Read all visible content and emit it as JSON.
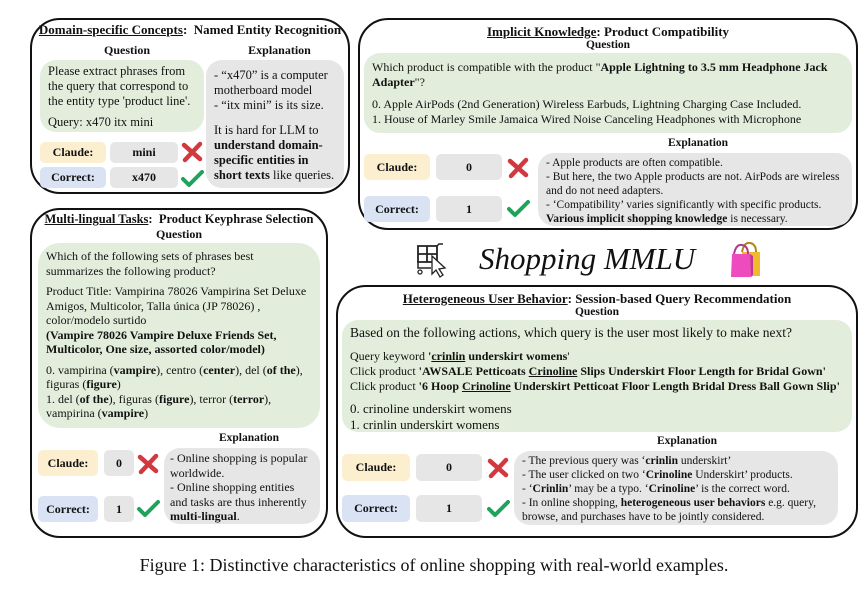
{
  "panels": {
    "ner": {
      "category": "Domain-specific Concepts",
      "task": "Named Entity Recognition",
      "question_header": "Question",
      "explanation_header": "Explanation",
      "question_lines": [
        "Please extract phrases from the query that correspond to the entity type 'product line'."
      ],
      "query": "Query: x470 itx mini",
      "claude_label": "Claude:",
      "claude_answer": "mini",
      "correct_label": "Correct:",
      "correct_answer": "x470",
      "explanation": {
        "b1": "- “x470” is a computer motherboard model",
        "b2": "- “itx mini” is its size.",
        "p_pre": "It is hard for LLM to ",
        "p_bold": "understand domain-specific entities in short texts",
        "p_post": " like queries."
      }
    },
    "compat": {
      "category": "Implicit Knowledge",
      "task": "Product Compatibility",
      "question_header": "Question",
      "explanation_header": "Explanation",
      "question_pre": "Which product is compatible with the product \"",
      "question_bold": "Apple Lightning to 3.5 mm Headphone Jack Adapter",
      "question_post": "\"?",
      "options": [
        "0. Apple AirPods (2nd Generation) Wireless Earbuds, Lightning Charging Case Included.",
        "1. House of Marley Smile Jamaica Wired Noise Canceling Headphones with Microphone"
      ],
      "claude_label": "Claude:",
      "claude_answer": "0",
      "correct_label": "Correct:",
      "correct_answer": "1",
      "explanation": {
        "b1": "- Apple products are often compatible.",
        "b2": "- But here, the two Apple products are not.  AirPods are wireless and do not need adapters.",
        "b3": "- ‘Compatibility’ varies significantly with specific products.",
        "b4_bold": "Various implicit shopping knowledge",
        "b4_post": " is necessary."
      }
    },
    "multilingual": {
      "category": "Multi-lingual Tasks",
      "task": "Product Keyphrase Selection",
      "question_header": "Question",
      "explanation_header": "Explanation",
      "question": "Which of the following sets of phrases best summarizes the following product?",
      "product_title": "Product Title: Vampirina 78026 Vampirina Set Deluxe Amigos, Multicolor, Talla única (JP 78026) , color/modelo surtido",
      "translation": "(Vampire 78026 Vampire Deluxe Friends Set, Multicolor, One size, assorted color/model)",
      "option0": [
        {
          "t": "0. vampirina (",
          "b": false
        },
        {
          "t": "vampire",
          "b": true
        },
        {
          "t": "), centro (",
          "b": false
        },
        {
          "t": "center",
          "b": true
        },
        {
          "t": "), del (",
          "b": false
        },
        {
          "t": "of the",
          "b": true
        },
        {
          "t": "), figuras (",
          "b": false
        },
        {
          "t": "figure",
          "b": true
        },
        {
          "t": ")",
          "b": false
        }
      ],
      "option1": [
        {
          "t": "1. del (",
          "b": false
        },
        {
          "t": "of the",
          "b": true
        },
        {
          "t": "), figuras (",
          "b": false
        },
        {
          "t": "figure",
          "b": true
        },
        {
          "t": "), terror (",
          "b": false
        },
        {
          "t": "terror",
          "b": true
        },
        {
          "t": "), vampirina (",
          "b": false
        },
        {
          "t": "vampire",
          "b": true
        },
        {
          "t": ")",
          "b": false
        }
      ],
      "claude_label": "Claude:",
      "claude_answer": "0",
      "correct_label": "Correct:",
      "correct_answer": "1",
      "explanation": {
        "b1": "- Online shopping is popular worldwide.",
        "b2_pre": "- Online shopping entities and tasks are thus inherently ",
        "b2_bold": "multi-lingual",
        "b2_post": "."
      }
    },
    "session": {
      "category": "Heterogeneous User Behavior",
      "task": "Session-based Query Recommendation",
      "question_header": "Question",
      "explanation_header": "Explanation",
      "question": "Based on the following actions, which query is the user most likely to make next?",
      "action1": {
        "pre": "Query keyword ",
        "q1": "'",
        "ul": "crinlin",
        "rest": " underskirt womens",
        "q2": "'"
      },
      "action2": {
        "pre": "Click product ",
        "b1": "'AWSALE Petticoats ",
        "ul": "Crinoline",
        "b2": " Slips Underskirt Floor Length for Bridal Gown'"
      },
      "action3": {
        "pre": "Click product ",
        "b1": "'6 Hoop ",
        "ul": "Crinoline",
        "b2": " Underskirt Petticoat Floor Length Bridal Dress Ball Gown Slip'"
      },
      "options": [
        "0. crinoline underskirt womens",
        "1. crinlin underskirt womens"
      ],
      "claude_label": "Claude:",
      "claude_answer": "0",
      "correct_label": "Correct:",
      "correct_answer": "1",
      "explanation": {
        "b1_pre": "- The previous query was ‘",
        "b1_bold": "crinlin",
        "b1_post": " underskirt’",
        "b2_pre": "- The user clicked on two ‘",
        "b2_bold": "Crinoline",
        "b2_post": " Underskirt’ products.",
        "b3_pre": "- ‘",
        "b3_bold1": "Crinlin",
        "b3_mid": "’ may be a typo. ‘",
        "b3_bold2": "Crinoline",
        "b3_post": "’ is the correct word.",
        "b4_pre": "- In online shopping, ",
        "b4_bold": "heterogeneous user behaviors",
        "b4_post": " e.g. query, browse,  and purchases have to be jointly considered."
      }
    }
  },
  "brand": {
    "title": "Shopping MMLU",
    "left_icon": "shopping-cart-cursor-icon",
    "right_icon": "shopping-bags-icon"
  },
  "caption": "Figure 1: Distinctive characteristics of online shopping with real-world examples.",
  "colors": {
    "question_bg": "#e2eedb",
    "explanation_bg": "#e6e6e6",
    "claude_bg": "#fcefcf",
    "correct_bg": "#dae3f3",
    "wrong_mark": "#d1393f",
    "right_mark": "#1fa35c"
  }
}
